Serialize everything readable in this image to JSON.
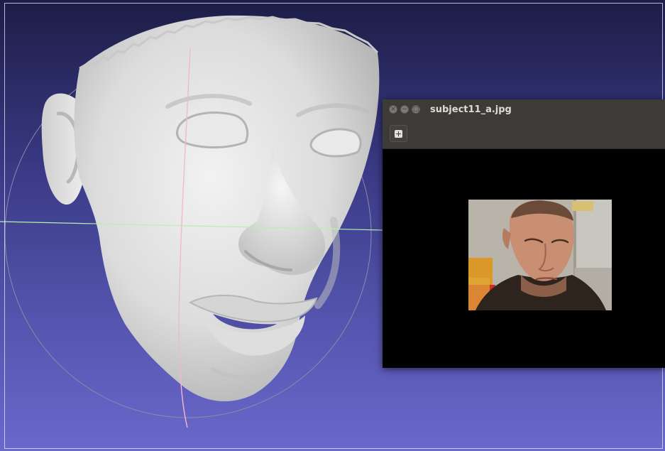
{
  "viewer": {
    "name": "3D mesh viewport",
    "colors": {
      "background_top": "#1d1d47",
      "background_bottom": "#6a68cc",
      "mesh": "#d8d8d8",
      "axis_vertical": "#f2b8d0",
      "axis_horizontal": "#b6f0b0",
      "trackball": "#9090a8"
    }
  },
  "image_window": {
    "title": "subject11_a.jpg",
    "controls": {
      "close_icon": "×",
      "minimize_icon": "−",
      "maximize_icon": "□"
    },
    "toolbar": {
      "zoom_icon": "plus-square-icon"
    },
    "background": "#000000"
  }
}
